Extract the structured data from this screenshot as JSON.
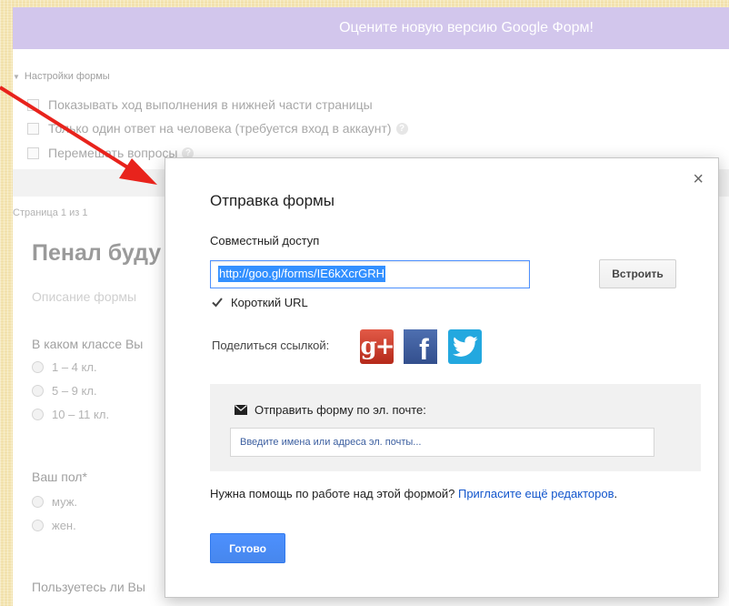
{
  "background": {
    "banner_text": "Оцените новую версию Google Форм!",
    "settings_header": "Настройки формы",
    "options": [
      {
        "label": "Показывать ход выполнения в нижней части страницы",
        "has_help": false
      },
      {
        "label": "Только один ответ на человека (требуется вход в аккаунт)",
        "has_help": true
      },
      {
        "label": "Перемешать вопросы",
        "has_help": true
      }
    ],
    "help_glyph": "?",
    "page_indicator": "Страница 1 из 1",
    "form_title": "Пенал буду",
    "form_description": "Описание формы",
    "question1": {
      "title": "В каком классе Вы",
      "options": [
        "1 – 4 кл.",
        "5 – 9 кл.",
        "10 – 11 кл."
      ]
    },
    "question2": {
      "title": "Ваш пол*",
      "options": [
        "муж.",
        "жен."
      ]
    },
    "question3": {
      "title": "Пользуетесь ли Вы"
    }
  },
  "dialog": {
    "close_glyph": "×",
    "title": "Отправка формы",
    "share_label": "Совместный доступ",
    "url": "http://goo.gl/forms/IE6kXcrGRH",
    "embed_button": "Встроить",
    "short_url_label": "Короткий URL",
    "short_url_checked": true,
    "share_link_label": "Поделиться ссылкой:",
    "social": [
      {
        "icon": "google-plus-icon",
        "glyph": "g+",
        "color": "#d73d32"
      },
      {
        "icon": "facebook-icon",
        "glyph": "f",
        "color": "#3b5998"
      },
      {
        "icon": "twitter-icon",
        "color": "#23a8df"
      }
    ],
    "email_label": "Отправить форму по эл. почте:",
    "email_placeholder": "Введите имена или адреса эл. почты...",
    "help_text": "Нужна помощь по работе над этой формой?",
    "help_link": "Пригласите ещё редакторов",
    "help_suffix": ".",
    "done_button": "Готово"
  },
  "colors": {
    "accent_blue": "#4d90fe",
    "banner_purple": "#d2c6ec",
    "arrow_red": "#e8231c",
    "link_blue": "#1155cc"
  }
}
